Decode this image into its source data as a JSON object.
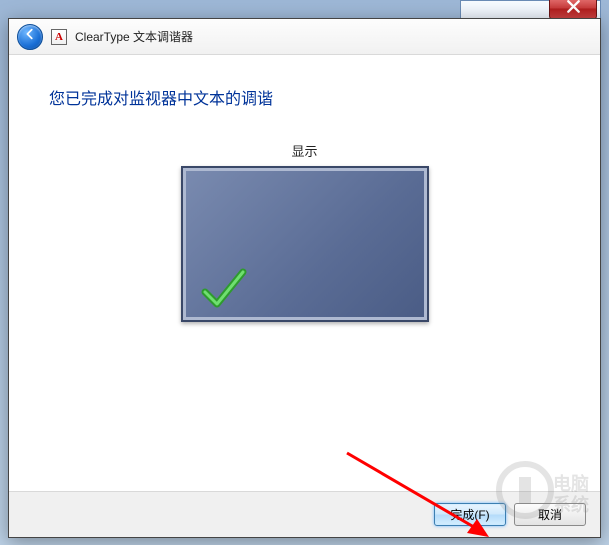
{
  "window": {
    "title": "ClearType 文本调谐器"
  },
  "content": {
    "headline": "您已完成对监视器中文本的调谐",
    "monitor_label": "显示"
  },
  "footer": {
    "finish_label": "完成(F)",
    "cancel_label": "取消"
  }
}
